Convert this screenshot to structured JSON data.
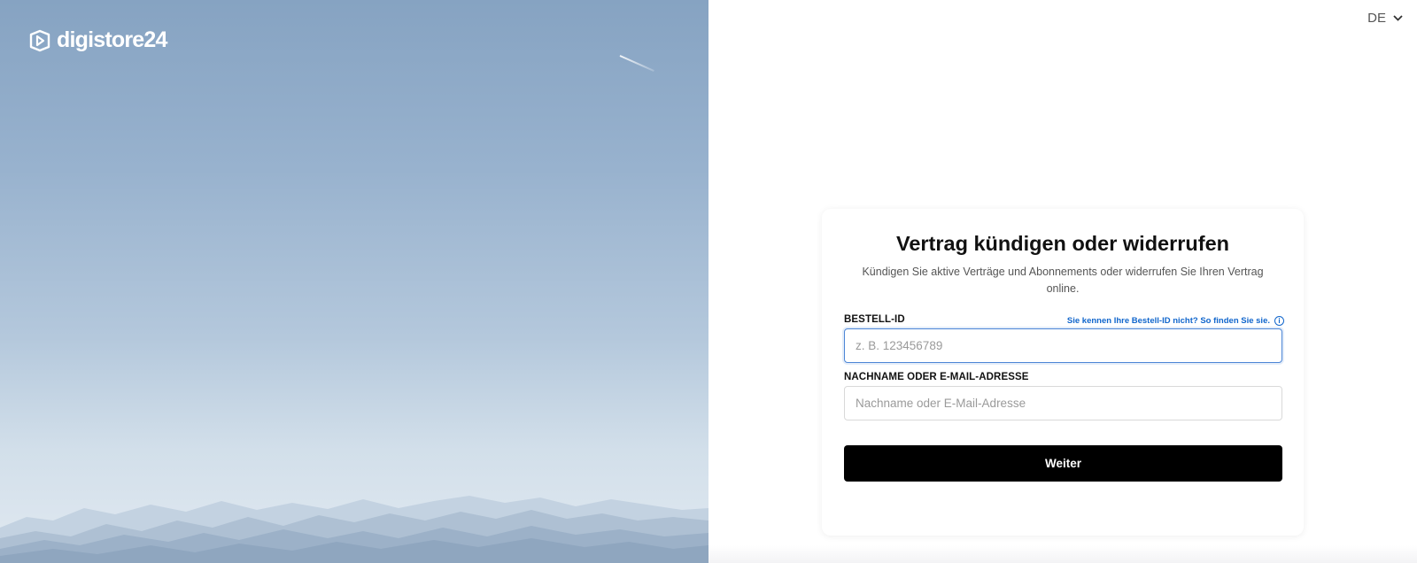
{
  "brand": {
    "logo_text": "digistore24",
    "logo_icon": "digistore24-logo-icon"
  },
  "language": {
    "selected": "DE",
    "icon": "chevron-down-icon"
  },
  "form": {
    "title": "Vertrag kündigen oder widerrufen",
    "subtitle": "Kündigen Sie aktive Verträge und Abonnements oder widerrufen Sie Ihren Vertrag online.",
    "order_id": {
      "label": "BESTELL-ID",
      "placeholder": "z. B. 123456789",
      "value": "",
      "help_link": "Sie kennen Ihre Bestell-ID nicht? So finden Sie sie.",
      "help_icon": "info-icon"
    },
    "name_or_email": {
      "label": "NACHNAME ODER E-MAIL-ADRESSE",
      "placeholder": "Nachname oder E-Mail-Adresse",
      "value": ""
    },
    "submit_label": "Weiter"
  },
  "colors": {
    "link": "#1166cc",
    "button_bg": "#000000",
    "focus_border": "#4d86d6"
  }
}
